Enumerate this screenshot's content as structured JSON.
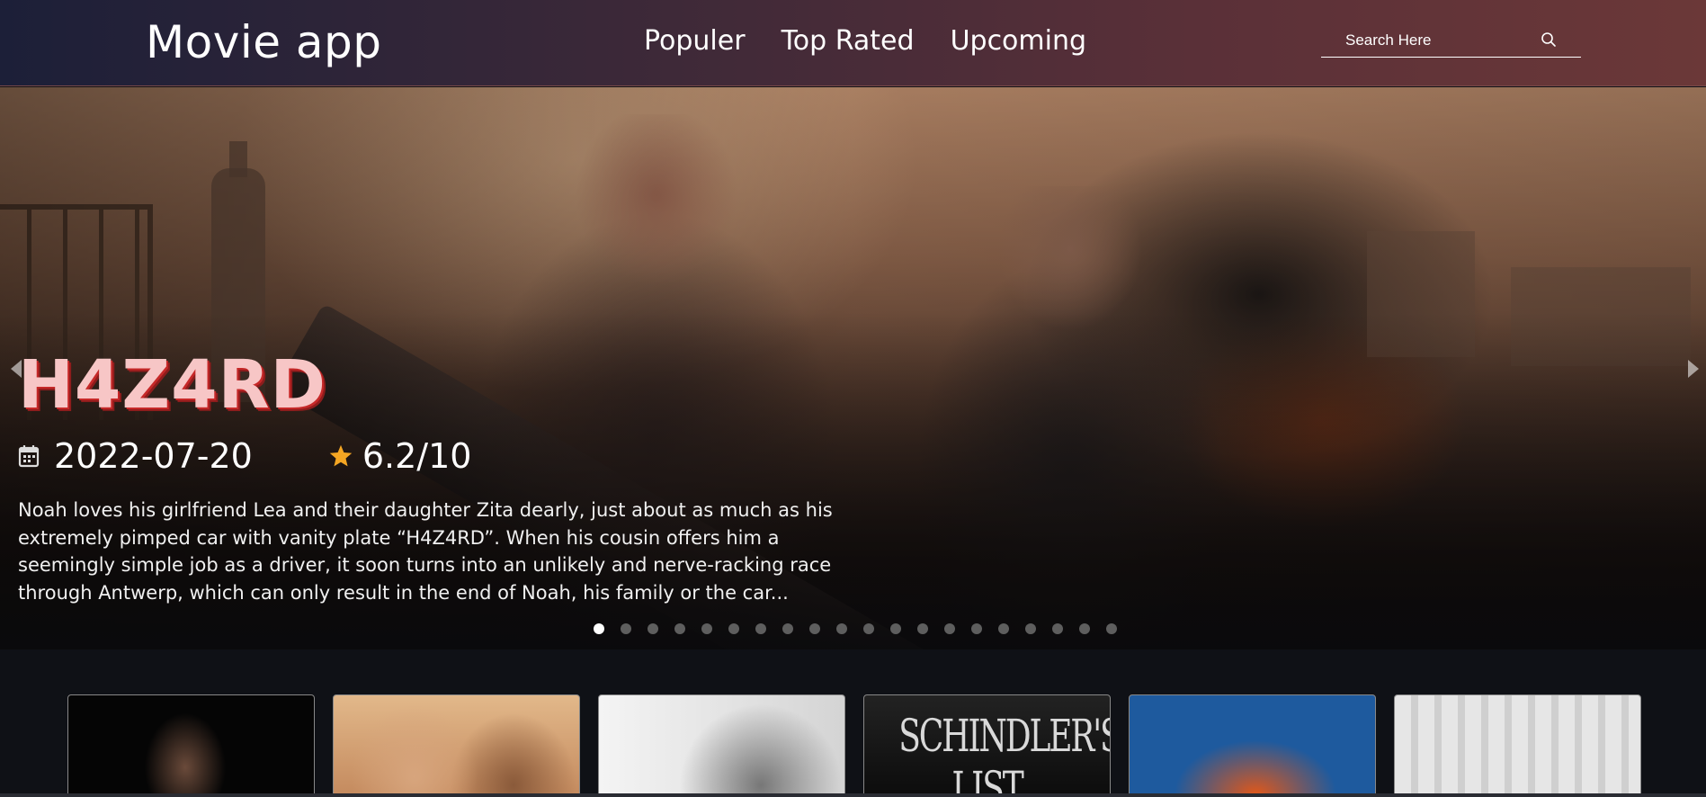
{
  "header": {
    "logo": "Movie app",
    "nav": [
      "Populer",
      "Top Rated",
      "Upcoming"
    ],
    "search_placeholder": "Search Here"
  },
  "hero": {
    "title": "H4Z4RD",
    "release_date": "2022-07-20",
    "rating": "6.2/10",
    "overview": "Noah loves his girlfriend Lea and their daughter Zita dearly, just about as much as his extremely pimped car with vanity plate “H4Z4RD”. When his cousin offers him a seemingly simple job as a driver, it soon turns into an unlikely and nerve-racking race through Antwerp, which can only result in the end of Noah, his family or the car...",
    "slide_count": 20,
    "active_slide": 1
  },
  "cards": [
    {
      "poster": "dark portrait of a man in a suit",
      "color": "#050505"
    },
    {
      "poster": "two men, one in a cap, warm tones",
      "color": "#d9a070"
    },
    {
      "poster": "black and white portrait",
      "color": "#e8e8e8"
    },
    {
      "poster_text": "SCHINDLER'S LIST",
      "color": "#1a1a1a"
    },
    {
      "poster": "couple on blue background",
      "color": "#1e5a9e"
    },
    {
      "poster": "group of men in front of columns",
      "color": "#d8d8d8"
    }
  ],
  "colors": {
    "header_start": "#1c1f38",
    "header_end": "#6b3838",
    "star": "#f5a623",
    "title": "#f7c6c6",
    "title_shadow": "#c62828"
  },
  "icons": [
    "search-icon",
    "calendar-icon",
    "star-icon",
    "chevron-left-icon",
    "chevron-right-icon"
  ]
}
